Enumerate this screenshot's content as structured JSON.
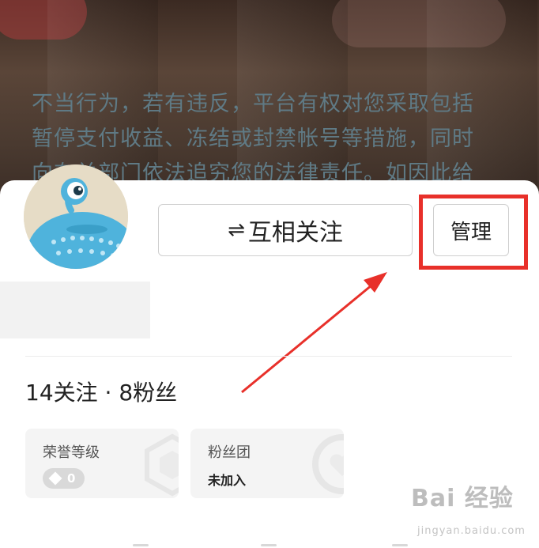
{
  "cover": {
    "notice_lines": [
      "不当行为，若有违反，平台有权对您采取包括",
      "暂停支付收益、冻结或封禁帐号等措施，同时",
      "向有关部门依法追究您的法律责任。如因此给"
    ]
  },
  "profile": {
    "follow_button": {
      "icon": "swap-arrows-icon",
      "label": "互相关注"
    },
    "manage_button": {
      "label": "管理"
    },
    "stats_text": "14关注 · 8粉丝"
  },
  "tiles": {
    "honor": {
      "label": "荣誉等级",
      "value": "0",
      "icon": "diamond-icon"
    },
    "fan_group": {
      "label": "粉丝团",
      "value": "未加入",
      "icon": "heart-badge-icon"
    }
  },
  "watermark": {
    "text": "Bai 经验",
    "sub": "jingyan.baidu.com"
  },
  "colors": {
    "highlight": "#e8302a",
    "arrow": "#e8302a",
    "avatar_creature": "#4fb3dc"
  }
}
